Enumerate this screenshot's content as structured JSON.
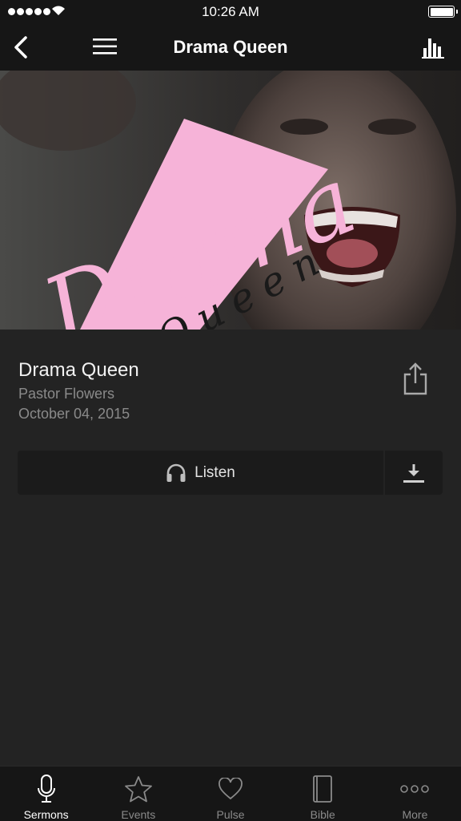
{
  "status_bar": {
    "time": "10:26 AM"
  },
  "nav": {
    "title": "Drama Queen"
  },
  "hero": {
    "word1": "Drama",
    "word2": "Queen"
  },
  "sermon": {
    "title": "Drama Queen",
    "speaker": "Pastor Flowers",
    "date": "October 04, 2015",
    "listen_label": "Listen"
  },
  "tabs": [
    {
      "label": "Sermons",
      "icon": "microphone-icon",
      "active": true
    },
    {
      "label": "Events",
      "icon": "star-icon",
      "active": false
    },
    {
      "label": "Pulse",
      "icon": "heart-icon",
      "active": false
    },
    {
      "label": "Bible",
      "icon": "book-icon",
      "active": false
    },
    {
      "label": "More",
      "icon": "more-dots-icon",
      "active": false
    }
  ],
  "colors": {
    "accent_pink": "#f6b3d8",
    "background": "#232323",
    "bar": "#161616"
  }
}
